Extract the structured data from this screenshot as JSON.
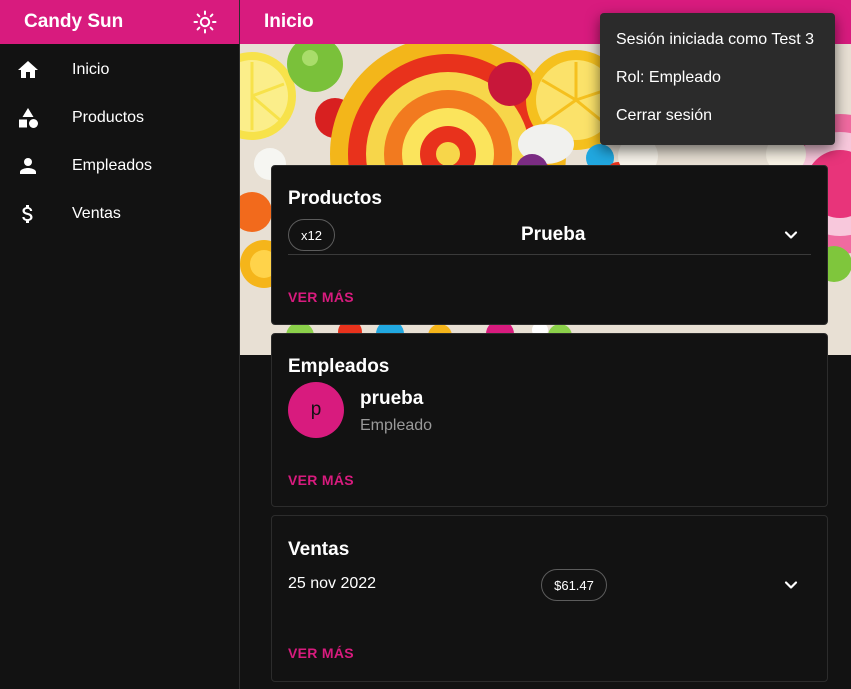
{
  "app": {
    "name": "Candy Sun"
  },
  "nav": [
    {
      "label": "Inicio",
      "icon": "home-icon"
    },
    {
      "label": "Productos",
      "icon": "category-icon"
    },
    {
      "label": "Empleados",
      "icon": "person-icon"
    },
    {
      "label": "Ventas",
      "icon": "dollar-icon"
    }
  ],
  "page": {
    "title": "Inicio"
  },
  "user_menu": {
    "items": [
      "Sesión iniciada como Test 3",
      "Rol: Empleado",
      "Cerrar sesión"
    ]
  },
  "productos": {
    "title": "Productos",
    "item": {
      "quantity": "x12",
      "name": "Prueba"
    },
    "more": "VER MÁS"
  },
  "empleados": {
    "title": "Empleados",
    "item": {
      "initial": "p",
      "name": "prueba",
      "role": "Empleado"
    },
    "more": "VER MÁS"
  },
  "ventas": {
    "title": "Ventas",
    "item": {
      "date": "25 nov 2022",
      "total": "$61.47"
    },
    "more": "VER MÁS"
  },
  "colors": {
    "accent": "#d81b7e",
    "background": "#121212",
    "menu": "#2b2b2b"
  }
}
